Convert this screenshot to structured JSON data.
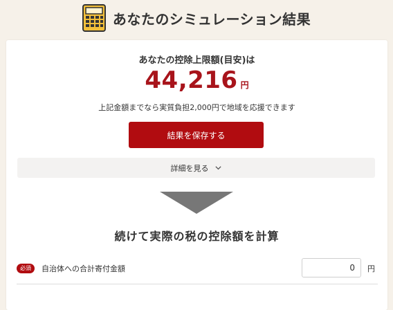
{
  "header": {
    "title": "あなたのシミュレーション結果",
    "icon": "calculator-icon"
  },
  "result": {
    "label": "あなたの控除上限額(目安)は",
    "amount": "44,216",
    "unit": "円",
    "note": "上記金額までなら実質負担2,000円で地域を応援できます"
  },
  "actions": {
    "save_label": "結果を保存する",
    "details_label": "詳細を見る"
  },
  "calc_section": {
    "title": "続けて実際の税の控除額を計算",
    "required_badge": "必須",
    "field_label": "自治体への合計寄付金額",
    "field_value": "0",
    "field_unit": "円"
  },
  "colors": {
    "accent": "#b10c10",
    "amount": "#a8141b",
    "background": "#f6f1e9"
  }
}
